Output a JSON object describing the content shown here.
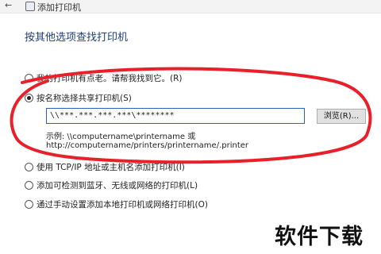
{
  "window": {
    "title": "添加打印机",
    "back_icon": "back-arrow-icon",
    "app_icon": "printer-wizard-icon"
  },
  "heading": "按其他选项查找打印机",
  "options": [
    {
      "label": "我的打印机有点老。请帮我找到它。(R)",
      "selected": false
    },
    {
      "label": "按名称选择共享打印机(S)",
      "selected": true
    },
    {
      "label": "使用 TCP/IP 地址或主机名添加打印机(I)",
      "selected": false
    },
    {
      "label": "添加可检测到蓝牙、无线或网络的打印机(L)",
      "selected": false
    },
    {
      "label": "通过手动设置添加本地打印机或网络打印机(O)",
      "selected": false
    }
  ],
  "shared_printer": {
    "value": "\\\\***.***.***.***\\********",
    "browse_label": "浏览(R)...",
    "example_line1": "示例: \\\\computername\\printername 或",
    "example_line2": "http://computername/printers/printername/.printer"
  },
  "watermark": "软件下载",
  "colors": {
    "annotation_red": "#e8202a",
    "input_border": "#2b62b8",
    "heading": "#1e3e7a"
  }
}
